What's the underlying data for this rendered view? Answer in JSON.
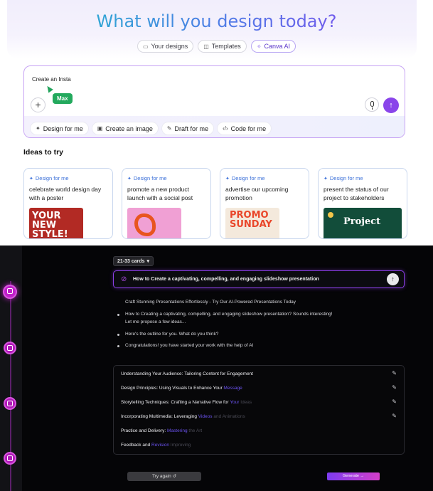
{
  "canva": {
    "title": "What will you design today?",
    "tabs": [
      {
        "label": "Your designs",
        "icon": "folder-icon"
      },
      {
        "label": "Templates",
        "icon": "template-icon"
      },
      {
        "label": "Canva AI",
        "icon": "sparkle-icon",
        "active": true
      }
    ],
    "prompt": {
      "value": "Create an Insta",
      "collaborator": "Max",
      "add_label": "+",
      "send_label": "↑"
    },
    "actions": [
      {
        "label": "Design for me",
        "icon": "magic-icon"
      },
      {
        "label": "Create an image",
        "icon": "image-icon"
      },
      {
        "label": "Draft for me",
        "icon": "pen-icon"
      },
      {
        "label": "Code for me",
        "icon": "code-icon"
      }
    ],
    "ideas_title": "Ideas to try",
    "ideas": [
      {
        "tag": "Design for me",
        "text": "celebrate world design day with a poster",
        "thumb_text": "YOUR NEW STYLE!"
      },
      {
        "tag": "Design for me",
        "text": "promote a new product launch with a social post",
        "thumb_text": ""
      },
      {
        "tag": "Design for me",
        "text": "advertise our upcoming promotion",
        "thumb_text": "PROMO SUNDAY"
      },
      {
        "tag": "Design for me",
        "text": "present the status of our project to stakeholders",
        "thumb_text": "Project"
      }
    ],
    "colors": {
      "accent": "#8a45ea",
      "tag": "#3a6fd8",
      "collaborator": "#23a95d"
    }
  },
  "generator": {
    "card_count": "21-33 cards",
    "prompt": "How to Create a captivating, compelling, and engaging slideshow presentation",
    "messages": [
      {
        "text": "Craft Stunning Presentations Effortlessly - Try Our AI-Powered Presentations Today",
        "bullet": false
      },
      {
        "text": "How to Creating a captivating, compelling, and engaging slideshow presentation? Sounds interesting!",
        "bullet": true
      },
      {
        "text": "Let me propose a few ideas...",
        "bullet": false
      },
      {
        "text": "Here's the outline for you. What do you think?",
        "bullet": true
      },
      {
        "text": "Congratulations! you have started your work with the help of AI",
        "bullet": true
      }
    ],
    "outline": [
      {
        "text": "Understanding Your Audience: Tailoring Content for Engagement",
        "hl": "",
        "fade": "",
        "editable": true
      },
      {
        "text": "Design Principles: Using Visuals to Enhance Your ",
        "hl": "Message",
        "fade": "",
        "editable": true
      },
      {
        "text": "Storytelling Techniques: Crafting a Narrative Flow for ",
        "hl": "Your",
        "fade": " Ideas",
        "editable": true
      },
      {
        "text": "Incorporating Multimedia: Leveraging ",
        "hl": "Videos",
        "fade": " and Animations",
        "editable": true
      },
      {
        "text": "Practice and Delivery: ",
        "hl": "Mastering",
        "fade": " the Art",
        "editable": false
      },
      {
        "text": "Feedback and ",
        "hl": "Revision",
        "fade": " Improving",
        "editable": false
      }
    ],
    "try_again": "Try again ↺",
    "generate": "Generate →",
    "colors": {
      "accent": "#8b3fe6",
      "rail": "#b01ab8"
    }
  }
}
